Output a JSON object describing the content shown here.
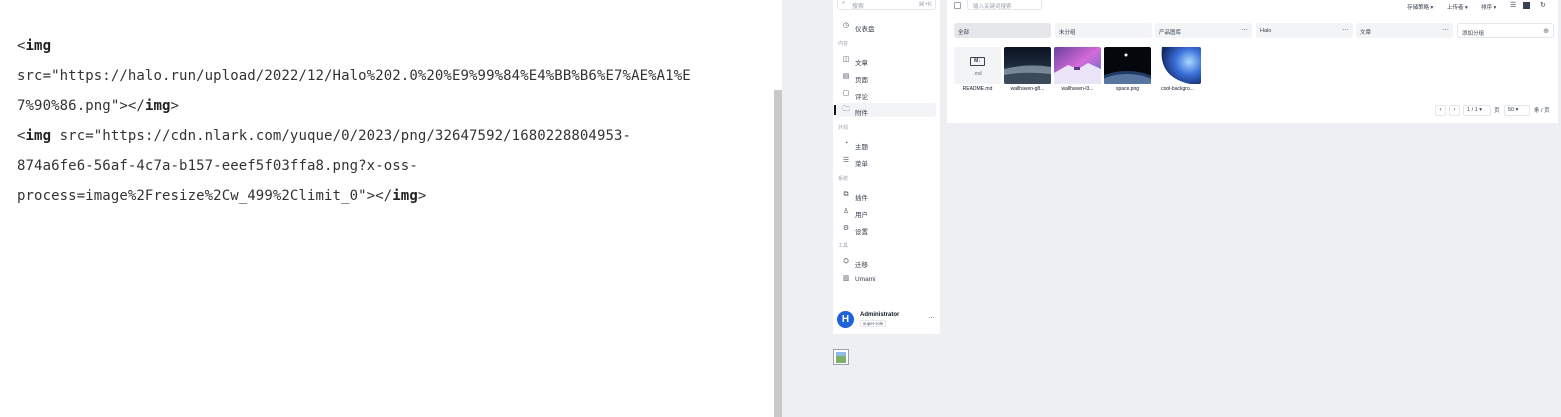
{
  "editor": {
    "lines": [
      [
        "<",
        "img",
        ""
      ],
      [
        "src=\"https://halo.run/upload/2022/12/Halo%202.0%20%E9%99%84%E4%BB%B6%E7%AE%A1%E",
        "",
        ""
      ],
      [
        "7%90%86.png\"></",
        "img",
        ">"
      ],
      [
        "<",
        "img",
        " src=\"https://cdn.nlark.com/yuque/0/2023/png/32647592/1680228804953-"
      ],
      [
        "874a6fe6-56af-4c7a-b157-eeef5f03ffa8.png?x-oss-",
        "",
        ""
      ],
      [
        "process=image%2Fresize%2Cw_499%2Climit_0\"></",
        "img",
        ">"
      ]
    ]
  },
  "sidebar": {
    "search_placeholder": "搜索",
    "search_shortcut": "⌘+K",
    "groups": [
      "内容",
      "外观",
      "系统",
      "工具"
    ],
    "items": [
      {
        "label": "仪表盘",
        "icon": "dashboard-icon",
        "glyph": "◷"
      },
      {
        "label": "文章",
        "icon": "post-icon",
        "glyph": "◫"
      },
      {
        "label": "页面",
        "icon": "page-icon",
        "glyph": "▤"
      },
      {
        "label": "评论",
        "icon": "comment-icon",
        "glyph": "▢"
      },
      {
        "label": "附件",
        "icon": "folder-icon",
        "glyph": "🗀"
      },
      {
        "label": "主题",
        "icon": "palette-icon",
        "glyph": "◔"
      },
      {
        "label": "菜单",
        "icon": "menu-icon",
        "glyph": "☰"
      },
      {
        "label": "插件",
        "icon": "plugin-icon",
        "glyph": "⧉"
      },
      {
        "label": "用户",
        "icon": "user-icon",
        "glyph": "♙"
      },
      {
        "label": "设置",
        "icon": "settings-icon",
        "glyph": "⚙"
      },
      {
        "label": "迁移",
        "icon": "migrate-icon",
        "glyph": "⛭"
      },
      {
        "label": "Umami",
        "icon": "chart-icon",
        "glyph": "▥"
      }
    ],
    "active_item": "附件",
    "user": {
      "name": "Administrator",
      "role": "super-role",
      "avatar_letter": "H"
    }
  },
  "attachments": {
    "keyword_placeholder": "输入关键词搜索",
    "filters": [
      "存储策略",
      "上传者",
      "排序"
    ],
    "groups": [
      {
        "label": "全部"
      },
      {
        "label": "未分组"
      },
      {
        "label": "产品图库"
      },
      {
        "label": "Halo"
      },
      {
        "label": "文章"
      },
      {
        "label": "添加分组"
      }
    ],
    "files": [
      {
        "name": "README.md",
        "ext": ".md",
        "logo": "M↓"
      },
      {
        "name": "wallhaven-g8...",
        "ext": ""
      },
      {
        "name": "wallhaven-l3...",
        "ext": ""
      },
      {
        "name": "space.png",
        "ext": ""
      },
      {
        "name": "cool-backgro...",
        "ext": ""
      }
    ],
    "pager": {
      "page": "1 / 1",
      "page_suffix": "页",
      "size": "50",
      "size_suffix": "条 / 页"
    }
  },
  "colors": {
    "avatar": "#1e63d8",
    "preview_bg": "#eeeff2"
  }
}
